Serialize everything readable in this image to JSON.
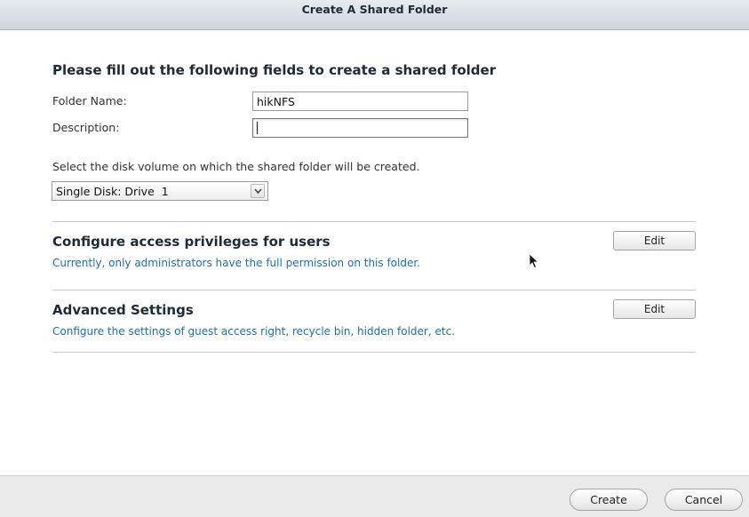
{
  "window": {
    "title": "Create A Shared Folder"
  },
  "form": {
    "heading": "Please fill out the following fields to create a shared folder",
    "folder_name": {
      "label": "Folder Name:",
      "value": "hikNFS"
    },
    "description": {
      "label": "Description:",
      "value": ""
    },
    "volume_prompt": "Select the disk volume on which the shared folder will be created.",
    "volume_selected": "Single Disk: Drive  1"
  },
  "sections": {
    "privileges": {
      "title": "Configure access privileges for users",
      "description": "Currently, only administrators have the full permission on this folder.",
      "button": "Edit"
    },
    "advanced": {
      "title": "Advanced Settings",
      "description": "Configure the settings of guest access right, recycle bin, hidden folder, etc.",
      "button": "Edit"
    }
  },
  "footer": {
    "create_label": "Create",
    "cancel_label": "Cancel"
  },
  "colors": {
    "link_blue": "#1f6fb0",
    "title_dark": "#1e2a35"
  },
  "icons": {
    "dropdown": "chevron-down-icon",
    "pointer": "mouse-pointer-icon"
  }
}
